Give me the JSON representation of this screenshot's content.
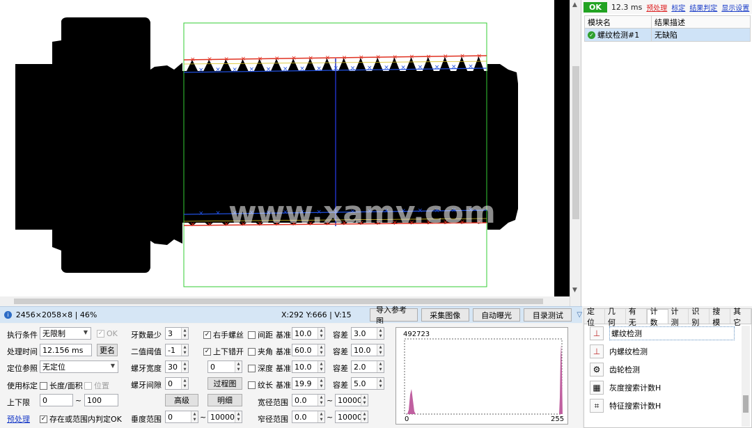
{
  "viewer": {
    "watermark": "www.xamv.com"
  },
  "right_panel": {
    "status": "OK",
    "time": "12.3 ms",
    "links": [
      "预处理",
      "标定",
      "结果判定",
      "显示设置"
    ],
    "columns": [
      "模块名",
      "结果描述"
    ],
    "rows": [
      {
        "name": "螺纹检测#1",
        "desc": "无缺陷"
      }
    ]
  },
  "statusbar": {
    "image_info": "2456×2058×8 | 46%",
    "coords": "X:292 Y:666 | V:15",
    "buttons": [
      "导入参考图",
      "采集图像",
      "自动曝光",
      "目录测试"
    ]
  },
  "params": {
    "left": {
      "exec_cond_label": "执行条件",
      "exec_cond_value": "无限制",
      "ok_label": "OK",
      "proc_time_label": "处理时间",
      "proc_time_value": "12.156 ms",
      "rename_btn": "更名",
      "locate_label": "定位参照",
      "locate_value": "无定位",
      "calib_label": "使用标定",
      "area_label": "长度/面积",
      "pos_label": "位置",
      "limit_label": "上下限",
      "limit_min": "0",
      "tilde": "~",
      "limit_max": "100",
      "preproc_link": "预处理",
      "range_ok_label": "存在或范围内判定OK"
    },
    "mid": {
      "min_teeth_label": "牙数最少",
      "min_teeth_value": "3",
      "bin_thresh_label": "二值阈值",
      "bin_thresh_value": "-1",
      "tooth_width_label": "螺牙宽度",
      "tooth_width_value": "30",
      "tooth_width_2": "0",
      "tooth_gap_label": "螺牙间隙",
      "tooth_gap_value": "0",
      "advanced_btn": "高级",
      "process_btn": "过程图",
      "detail_btn": "明细",
      "vert_range_label": "垂度范围",
      "vert_min": "0",
      "vert_max": "10000",
      "right_thread_label": "右手螺丝",
      "stagger_label": "上下错开"
    },
    "checks": [
      {
        "label": "间距",
        "base": "10.0",
        "tol": "3.0"
      },
      {
        "label": "夹角",
        "base": "60.0",
        "tol": "10.0"
      },
      {
        "label": "深度",
        "base": "10.0",
        "tol": "2.0"
      },
      {
        "label": "纹长",
        "base": "19.9",
        "tol": "5.0"
      }
    ],
    "base_label": "基准",
    "tol_label": "容差",
    "wide_range_label": "宽径范围",
    "wide_min": "0.0",
    "wide_max": "10000.",
    "narrow_range_label": "窄径范围",
    "narrow_min": "0.0",
    "narrow_max": "10000."
  },
  "histogram": {
    "max_count": "492723",
    "x_min": "0",
    "x_max": "255"
  },
  "tools": {
    "tabs": [
      "定位",
      "几何",
      "有无",
      "计数",
      "计测",
      "识别",
      "搜模",
      "其它"
    ],
    "active_tab": "计数",
    "items": [
      {
        "name": "螺纹检测",
        "icon": "screw-icon"
      },
      {
        "name": "内螺纹检测",
        "icon": "nut-icon"
      },
      {
        "name": "齿轮检测",
        "icon": "gear-icon"
      },
      {
        "name": "灰度搜索计数H",
        "icon": "gray-search-icon"
      },
      {
        "name": "特征搜索计数H",
        "icon": "feature-search-icon"
      }
    ]
  },
  "colors": {
    "ok_green": "#22a322",
    "roi_green": "#33cc33",
    "edge_red": "#e03020",
    "edge_blue": "#2050e0",
    "statusbar_blue": "#d6e6f5"
  }
}
